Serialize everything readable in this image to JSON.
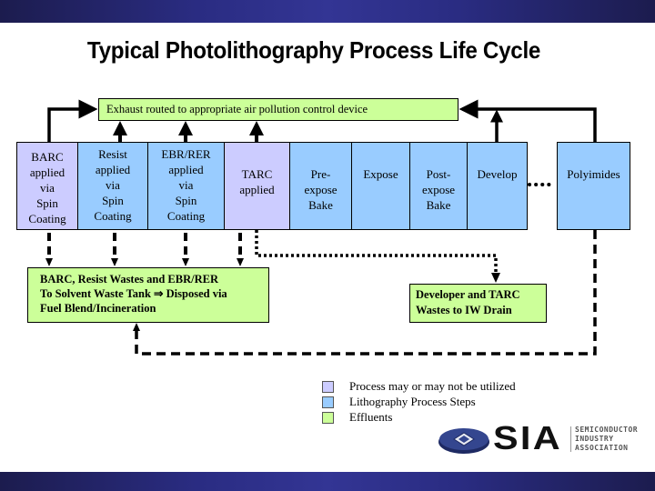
{
  "title": "Typical Photolithography Process Life Cycle",
  "colors": {
    "effluent": "#ccff99",
    "optional_process": "#ccccff",
    "lithography_step": "#99ccff",
    "banner": "#2a2c82"
  },
  "exhaust": {
    "label": "Exhaust routed to appropriate air pollution control device"
  },
  "process_steps": [
    {
      "id": "barc",
      "label": "BARC\napplied\nvia\nSpin\nCoating",
      "category": "optional_process"
    },
    {
      "id": "resist",
      "label": "Resist\napplied\nvia\nSpin\nCoating",
      "category": "lithography_step"
    },
    {
      "id": "ebr-rer",
      "label": "EBR/RER\napplied\nvia\nSpin\nCoating",
      "category": "lithography_step"
    },
    {
      "id": "tarc",
      "label": "TARC\napplied",
      "category": "optional_process"
    },
    {
      "id": "pre-expose-bake",
      "label": "Pre-\nexpose\nBake",
      "category": "lithography_step"
    },
    {
      "id": "expose",
      "label": "Expose",
      "category": "lithography_step"
    },
    {
      "id": "post-expose-bake",
      "label": "Post-\nexpose\nBake",
      "category": "lithography_step"
    },
    {
      "id": "develop",
      "label": "Develop",
      "category": "lithography_step"
    },
    {
      "id": "polyimides",
      "label": "Polyimides",
      "category": "lithography_step"
    }
  ],
  "effluents": {
    "solvent_waste": "BARC, Resist Wastes and EBR/RER\nTo Solvent Waste Tank ⇒ Disposed via\nFuel Blend/Incineration",
    "developer_waste": "Developer and TARC\nWastes to IW Drain"
  },
  "legend": [
    {
      "label": "Process may or may not be utilized",
      "category": "optional_process"
    },
    {
      "label": "Lithography Process Steps",
      "category": "lithography_step"
    },
    {
      "label": "Effluents",
      "category": "effluent"
    }
  ],
  "logo": {
    "letters": "SIA",
    "subtitle": "SEMICONDUCTOR\nINDUSTRY\nASSOCIATION"
  }
}
